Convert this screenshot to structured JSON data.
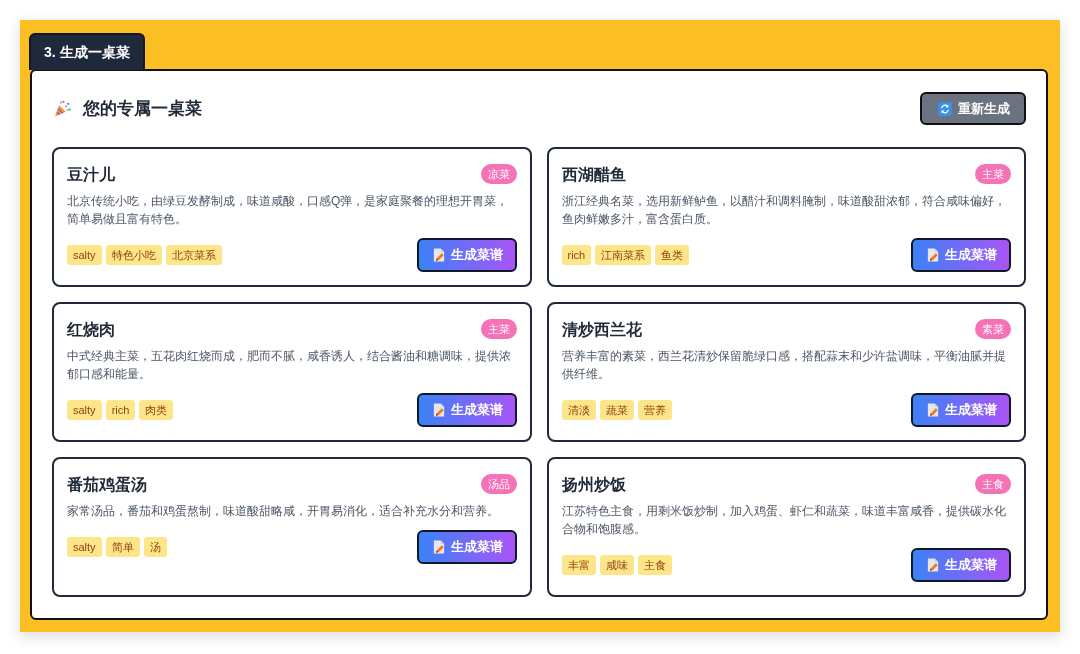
{
  "section_tab": {
    "label": "3. 生成一桌菜"
  },
  "header": {
    "title": "您的专属一桌菜",
    "regenerate_button": "重新生成"
  },
  "dishes": [
    {
      "name": "豆汁儿",
      "category": "凉菜",
      "description": "北京传统小吃，由绿豆发酵制成，味道咸酸，口感Q弹，是家庭聚餐的理想开胃菜，简单易做且富有特色。",
      "tags": [
        "salty",
        "特色小吃",
        "北京菜系"
      ],
      "button": "生成菜谱"
    },
    {
      "name": "西湖醋鱼",
      "category": "主菜",
      "description": "浙江经典名菜，选用新鲜鲈鱼，以醋汁和调料腌制，味道酸甜浓郁，符合咸味偏好，鱼肉鲜嫩多汁，富含蛋白质。",
      "tags": [
        "rich",
        "江南菜系",
        "鱼类"
      ],
      "button": "生成菜谱"
    },
    {
      "name": "红烧肉",
      "category": "主菜",
      "description": "中式经典主菜，五花肉红烧而成，肥而不腻，咸香诱人，结合酱油和糖调味，提供浓郁口感和能量。",
      "tags": [
        "salty",
        "rich",
        "肉类"
      ],
      "button": "生成菜谱"
    },
    {
      "name": "清炒西兰花",
      "category": "素菜",
      "description": "营养丰富的素菜，西兰花清炒保留脆绿口感，搭配蒜末和少许盐调味，平衡油腻并提供纤维。",
      "tags": [
        "清淡",
        "蔬菜",
        "营养"
      ],
      "button": "生成菜谱"
    },
    {
      "name": "番茄鸡蛋汤",
      "category": "汤品",
      "description": "家常汤品，番茄和鸡蛋熬制，味道酸甜略咸，开胃易消化，适合补充水分和营养。",
      "tags": [
        "salty",
        "简单",
        "汤"
      ],
      "button": "生成菜谱"
    },
    {
      "name": "扬州炒饭",
      "category": "主食",
      "description": "江苏特色主食，用剩米饭炒制，加入鸡蛋、虾仁和蔬菜，味道丰富咸香，提供碳水化合物和饱腹感。",
      "tags": [
        "丰富",
        "咸味",
        "主食"
      ],
      "button": "生成菜谱"
    }
  ]
}
